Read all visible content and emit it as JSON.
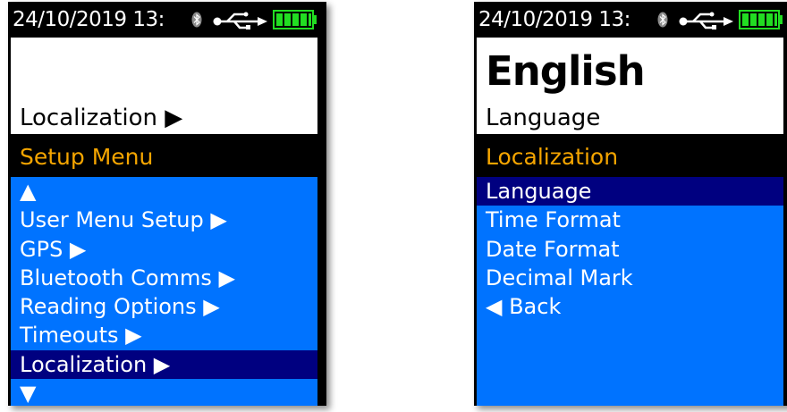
{
  "colors": {
    "screen_bg": "#000000",
    "info_bg": "#ffffff",
    "menu_bg": "#0073ff",
    "menu_selected_bg": "#000080",
    "title_text": "#f5a500",
    "text": "#ffffff",
    "battery": "#22dd22"
  },
  "left": {
    "status": {
      "datetime": "24/10/2019  13:",
      "icons": [
        "bluetooth-icon",
        "usb-icon",
        "battery-icon"
      ]
    },
    "info": {
      "value": "",
      "label": "Localization ▶"
    },
    "title": "Setup Menu",
    "menu": {
      "items": [
        {
          "label": "▲"
        },
        {
          "label": "User Menu Setup ▶"
        },
        {
          "label": "GPS ▶"
        },
        {
          "label": "Bluetooth Comms ▶"
        },
        {
          "label": "Reading Options ▶"
        },
        {
          "label": "Timeouts ▶"
        },
        {
          "label": "Localization ▶"
        },
        {
          "label": "▼"
        }
      ],
      "selected_index": 6
    }
  },
  "right": {
    "status": {
      "datetime": "24/10/2019  13:",
      "icons": [
        "bluetooth-icon",
        "usb-icon",
        "battery-icon"
      ]
    },
    "info": {
      "value": "English",
      "label": "Language"
    },
    "title": "Localization",
    "menu": {
      "items": [
        {
          "label": "Language"
        },
        {
          "label": "Time Format"
        },
        {
          "label": "Date Format"
        },
        {
          "label": "Decimal Mark"
        },
        {
          "label": "◀ Back"
        }
      ],
      "selected_index": 0
    }
  }
}
